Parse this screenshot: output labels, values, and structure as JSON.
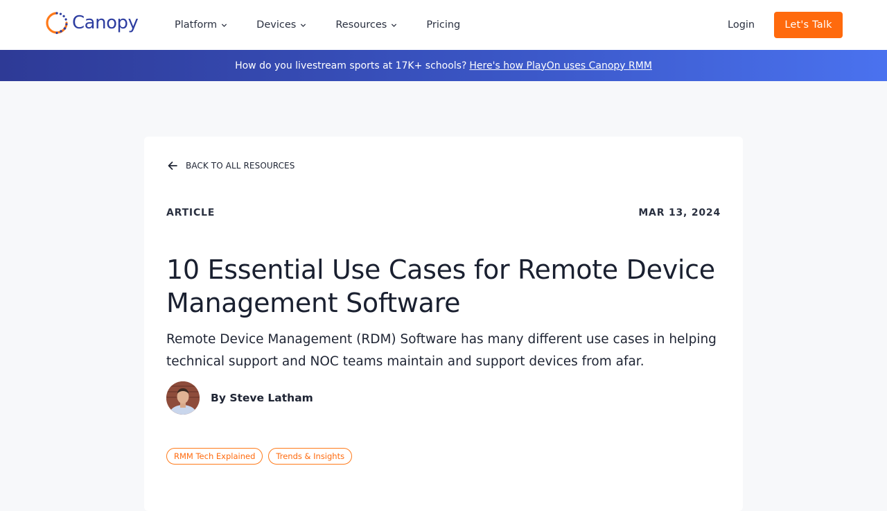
{
  "header": {
    "logo_text": "Canopy",
    "nav": [
      {
        "label": "Platform",
        "has_dropdown": true
      },
      {
        "label": "Devices",
        "has_dropdown": true
      },
      {
        "label": "Resources",
        "has_dropdown": true
      },
      {
        "label": "Pricing",
        "has_dropdown": false
      }
    ],
    "login_label": "Login",
    "cta_label": "Let's Talk"
  },
  "banner": {
    "text": "How do you livestream sports at 17K+ schools?",
    "link_text": "Here's how PlayOn uses Canopy RMM"
  },
  "article": {
    "back_label": "BACK TO ALL RESOURCES",
    "type": "ARTICLE",
    "date": "MAR 13, 2024",
    "title": "10 Essential Use Cases for Remote Device Management Software",
    "subtitle": "Remote Device Management (RDM) Software has many different use cases in helping technical support and NOC teams maintain and support devices from afar.",
    "author": "By Steve Latham",
    "tags": [
      "RMM Tech Explained",
      "Trends & Insights"
    ]
  },
  "colors": {
    "brand_blue": "#2d3da0",
    "accent_orange": "#ff6a0d",
    "banner_start": "#2e3a96",
    "banner_end": "#4a72ef",
    "page_bg": "#f7f8fa"
  },
  "icons": {
    "logo": "canopy-logo-icon",
    "chevron": "chevron-down-icon",
    "back": "arrow-left-icon"
  }
}
